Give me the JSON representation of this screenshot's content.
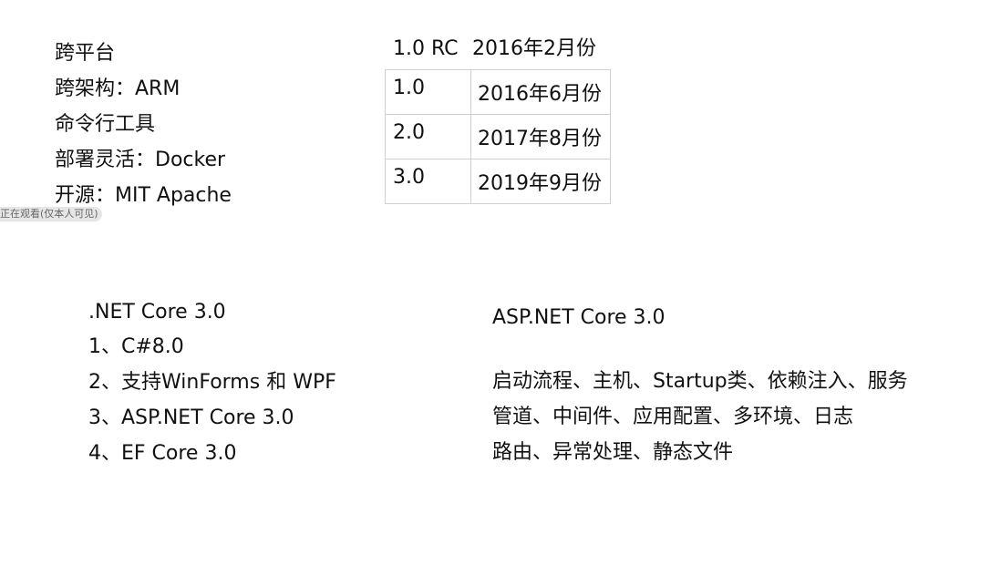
{
  "features": [
    "跨平台",
    "跨架构：ARM",
    "命令行工具",
    "部署灵活：Docker",
    "开源：MIT Apache"
  ],
  "watermark": "正在观看(仅本人可见)",
  "releases": {
    "header": {
      "version": "1.0 RC",
      "date": "2016年2月份"
    },
    "rows": [
      {
        "version": "1.0",
        "date": "2016年6月份"
      },
      {
        "version": "2.0",
        "date": "2017年8月份"
      },
      {
        "version": "3.0",
        "date": "2019年9月份"
      }
    ]
  },
  "netcore": {
    "title": ".NET Core 3.0",
    "items": [
      "1、C#8.0",
      "2、支持WinForms 和 WPF",
      "3、ASP.NET Core 3.0",
      "4、EF Core 3.0"
    ]
  },
  "aspnetcore": {
    "title": "ASP.NET Core 3.0",
    "items": [
      "启动流程、主机、Startup类、依赖注入、服务",
      "管道、中间件、应用配置、多环境、日志",
      "路由、异常处理、静态文件"
    ]
  }
}
